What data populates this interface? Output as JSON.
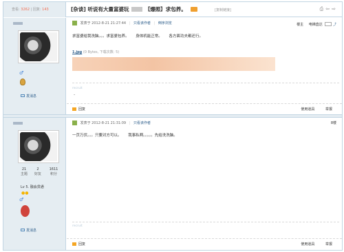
{
  "header": {
    "views_label": "查看:",
    "views_value": "3262",
    "sep": "|",
    "replies_label": "回复:",
    "replies_value": "143",
    "title_prefix": "[杂谈]",
    "title_main": "听说有大量富婆玩",
    "title_tag": "【爆照】求包养。",
    "copy_link": "[复制链接]"
  },
  "posts": [
    {
      "meta": {
        "posted": "发表于 2012-8-21 21:27:44",
        "only_author": "只看该作者",
        "reverse": "倒序浏览"
      },
      "floor": "楼主",
      "floor_extra": "电梯直达",
      "body": "求富婆给我洗脑。。。求富婆包养。 身体机能正常。 各方面功夫都还行。",
      "attachment_name": "1.jpg",
      "attachment_info": "(0 Bytes, 下载次数: 5)",
      "sig": "recruit",
      "dot": "-",
      "send_msg": "发消息",
      "reply": "回复",
      "tools": "使用道具",
      "report": "举报"
    },
    {
      "meta": {
        "posted": "发表于 2012-8-21 21:31:09",
        "only_author": "只看该作者"
      },
      "floor": "8楼",
      "body": "一页万伏。。。只要对方可以。 我事私啊。。。。。先给洗洗脑。",
      "sig": "recruit",
      "send_msg": "发消息",
      "stats": [
        {
          "value": "21",
          "label": "主题"
        },
        {
          "value": "2",
          "label": "好友"
        },
        {
          "value": "1611",
          "label": "积分"
        }
      ],
      "level": "Lv 5. 融会贯通",
      "stars": "●●",
      "reply": "回复",
      "tools": "使用道具",
      "report": "举报"
    }
  ]
}
